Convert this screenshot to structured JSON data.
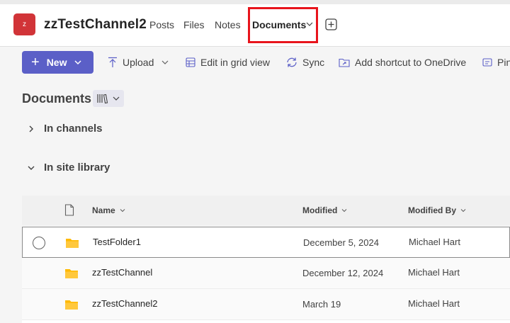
{
  "header": {
    "avatar_letter": "z",
    "channel_name": "zzTestChannel2",
    "tabs": [
      {
        "label": "Posts"
      },
      {
        "label": "Files"
      },
      {
        "label": "Notes"
      },
      {
        "label": "Documents",
        "active": true
      }
    ],
    "highlight_color": "#e8141c",
    "add_tab_icon": "add-tab-icon"
  },
  "toolbar": {
    "new_label": "New",
    "upload_label": "Upload",
    "grid_label": "Edit in grid view",
    "sync_label": "Sync",
    "shortcut_label": "Add shortcut to OneDrive",
    "pin_label": "Pin"
  },
  "library": {
    "title": "Documents",
    "sections": [
      {
        "label": "In channels",
        "expanded": false
      },
      {
        "label": "In site library",
        "expanded": true
      }
    ]
  },
  "table": {
    "columns": {
      "name": "Name",
      "modified": "Modified",
      "modified_by": "Modified By"
    },
    "rows": [
      {
        "name": "TestFolder1",
        "modified": "December 5, 2024",
        "modified_by": "Michael Hart",
        "selected": true
      },
      {
        "name": "zzTestChannel",
        "modified": "December 12, 2024",
        "modified_by": "Michael Hart"
      },
      {
        "name": "zzTestChannel2",
        "modified": "March 19",
        "modified_by": "Michael Hart"
      }
    ]
  },
  "colors": {
    "accent": "#5b5fc7",
    "avatar": "#d13438",
    "folder": "#ffb900"
  }
}
